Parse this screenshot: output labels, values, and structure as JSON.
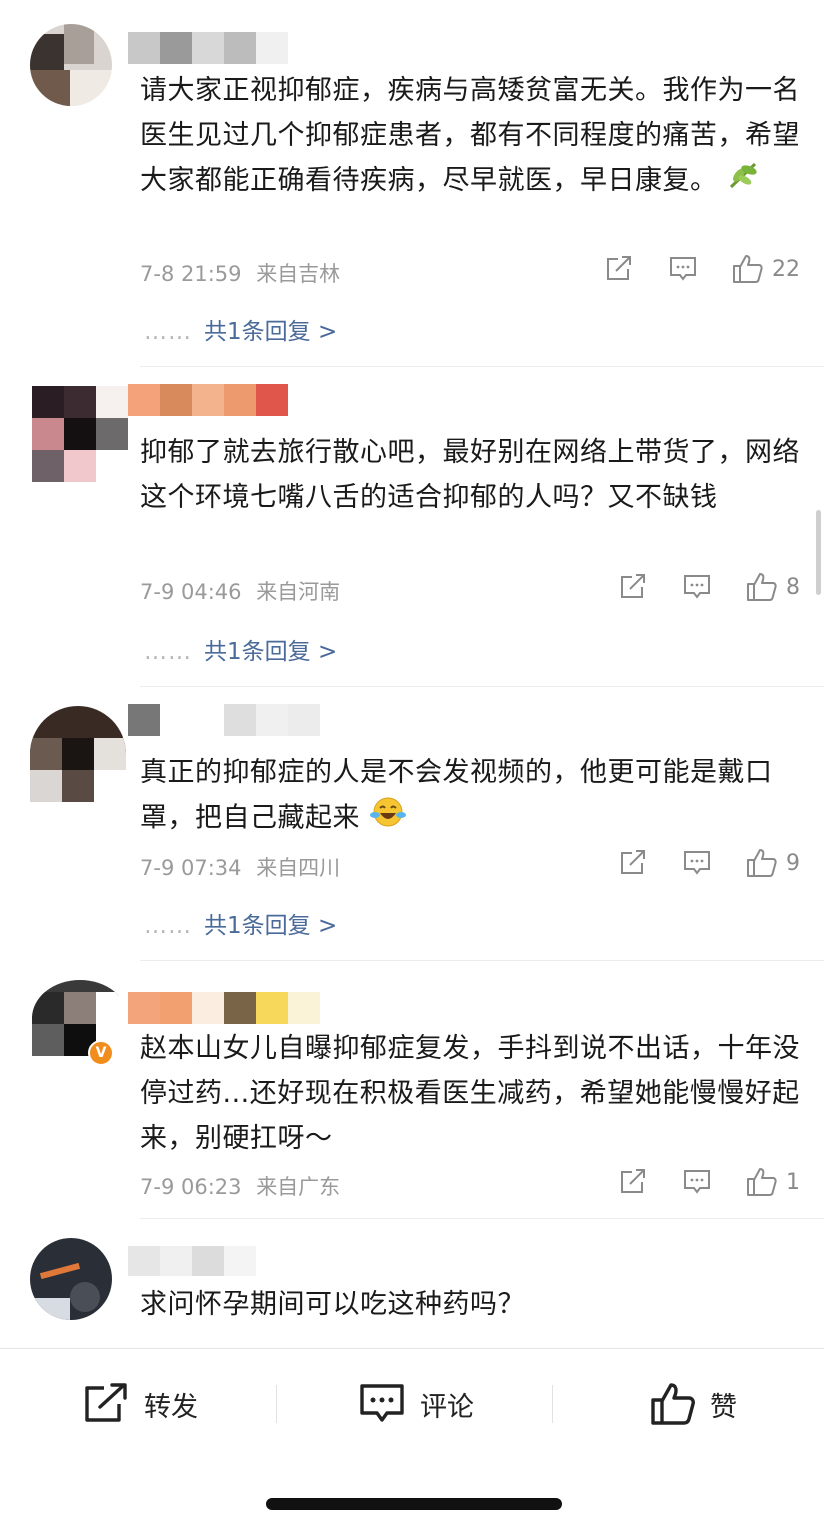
{
  "comments": [
    {
      "text": "请大家正视抑郁症，疾病与高矮贫富无关。我作为一名医生见过几个抑郁症患者，都有不同程度的痛苦，希望大家都能正确看待疾病，尽早就医，早日康复。",
      "emoji": "leaf-emoji",
      "time": "7-8 21:59",
      "location": "来自吉林",
      "likes": "22",
      "reply_dots": "……",
      "reply_link": "共1条回复 >"
    },
    {
      "text": "抑郁了就去旅行散心吧，最好别在网络上带货了，网络这个环境七嘴八舌的适合抑郁的人吗？又不缺钱",
      "time": "7-9 04:46",
      "location": "来自河南",
      "likes": "8",
      "reply_dots": "……",
      "reply_link": "共1条回复 >"
    },
    {
      "text": "真正的抑郁症的人是不会发视频的，他更可能是戴口罩，把自己藏起来",
      "emoji": "laugh-cry-emoji",
      "time": "7-9 07:34",
      "location": "来自四川",
      "likes": "9",
      "reply_dots": "……",
      "reply_link": "共1条回复 >"
    },
    {
      "text": "赵本山女儿自曝抑郁症复发，手抖到说不出话，十年没停过药...还好现在积极看医生减药，希望她能慢慢好起来，别硬扛呀～",
      "time": "7-9 06:23",
      "location": "来自广东",
      "likes": "1",
      "verified_badge": "V"
    },
    {
      "text": "求问怀孕期间可以吃这种药吗？"
    }
  ],
  "bottom_bar": {
    "repost": "转发",
    "comment": "评论",
    "like": "赞"
  },
  "icons": [
    "repost-icon",
    "comment-icon",
    "like-icon"
  ],
  "colors": {
    "link": "#4a6a9a",
    "meta": "#9a9a9a",
    "badge": "#f08d1c"
  }
}
